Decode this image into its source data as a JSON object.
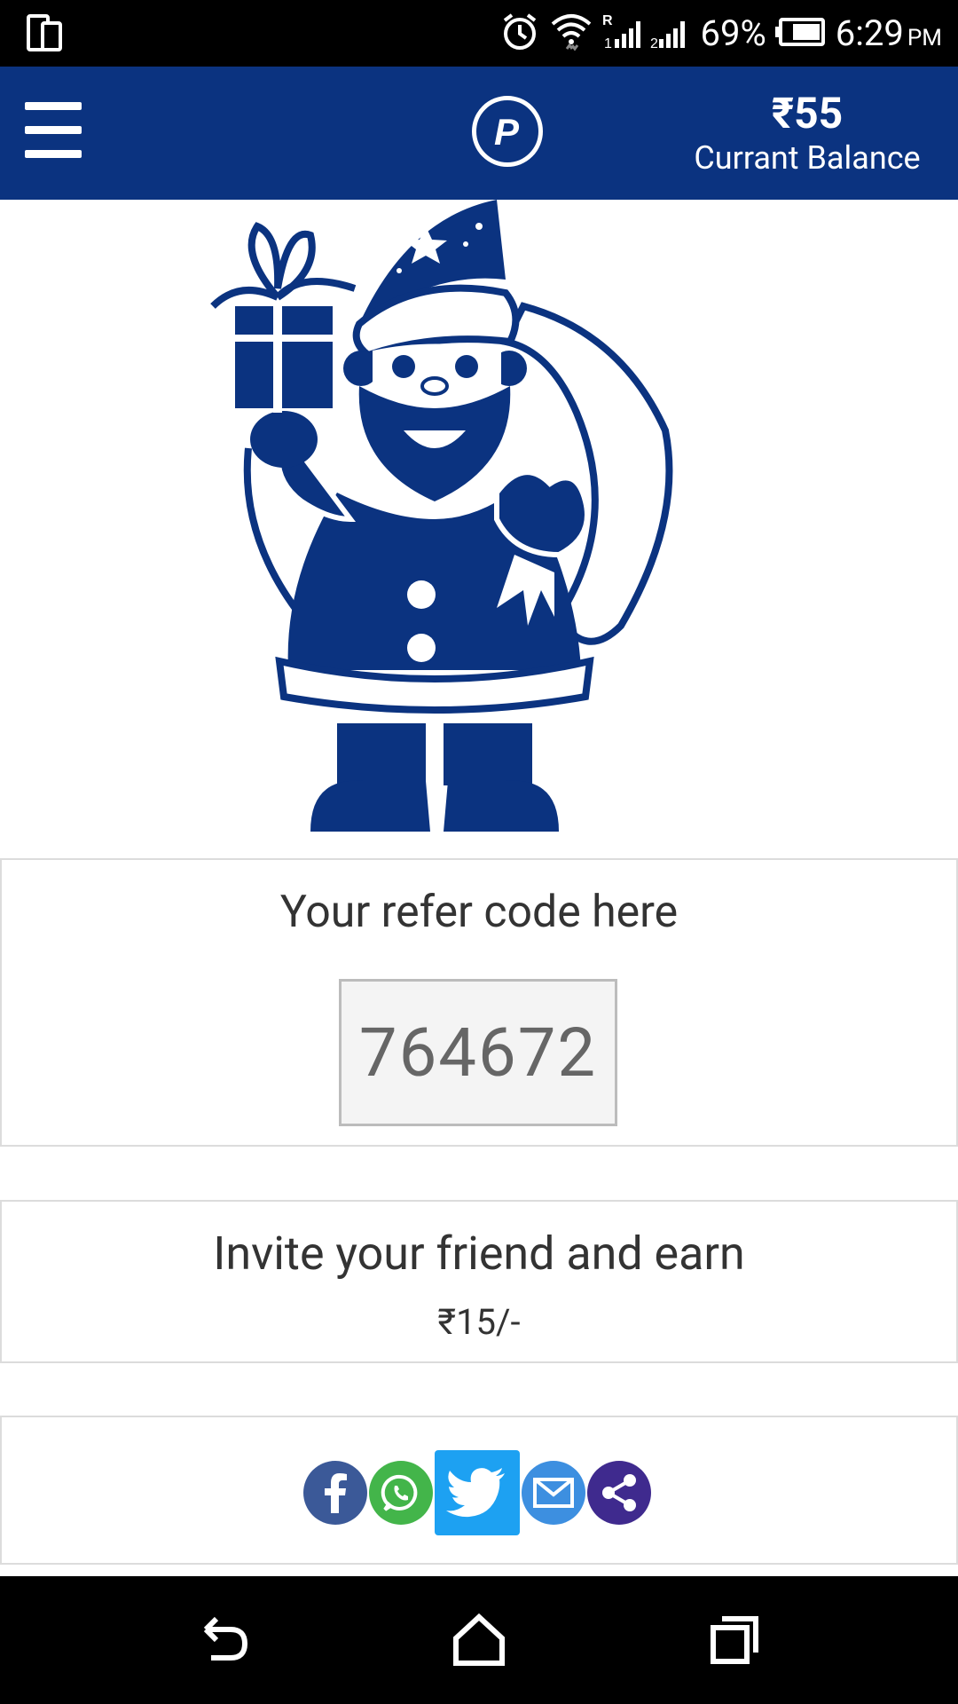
{
  "status_bar": {
    "battery": "69%",
    "time": "6:29",
    "time_suffix": "PM",
    "icons": [
      "device-icon",
      "alarm-icon",
      "wifi-icon",
      "signal-icon",
      "battery-icon"
    ]
  },
  "app_bar": {
    "logo_letter": "P",
    "balance_amount": "₹55",
    "balance_label": "Currant Balance",
    "brand_color": "#0b3380"
  },
  "refer": {
    "title": "Your refer code here",
    "code": "764672"
  },
  "invite": {
    "title": "Invite your friend and earn",
    "amount": "₹15/-"
  },
  "share": {
    "icons": [
      "facebook-icon",
      "whatsapp-icon",
      "twitter-icon",
      "email-icon",
      "share-icon"
    ]
  },
  "nav": {
    "icons": [
      "back-icon",
      "home-icon",
      "recents-icon"
    ]
  }
}
